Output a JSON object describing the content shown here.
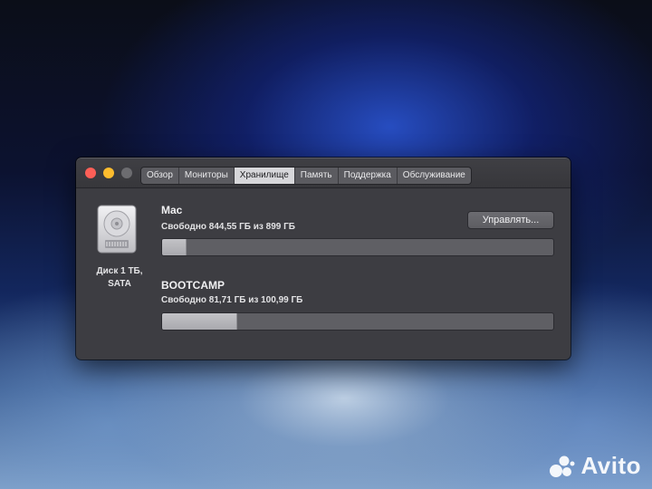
{
  "tabs": [
    "Обзор",
    "Мониторы",
    "Хранилище",
    "Память",
    "Поддержка",
    "Обслуживание"
  ],
  "active_tab": "Хранилище",
  "disk": {
    "icon": "hard-drive-icon",
    "label_line1": "Диск 1 ТБ,",
    "label_line2": "SATA"
  },
  "volumes": [
    {
      "name": "Mac",
      "free_text": "Свободно 844,55 ГБ из 899 ГБ",
      "used_fraction": 0.06
    },
    {
      "name": "BOOTCAMP",
      "free_text": "Свободно 81,71 ГБ из 100,99 ГБ",
      "used_fraction": 0.19
    }
  ],
  "manage_button": "Управлять...",
  "watermark": {
    "text": "Avito",
    "icon": "avito-logo-icon"
  },
  "colors": {
    "close": "#fc5f57",
    "minimize": "#fdbc2e",
    "zoom_disabled": "#6c6c70"
  }
}
